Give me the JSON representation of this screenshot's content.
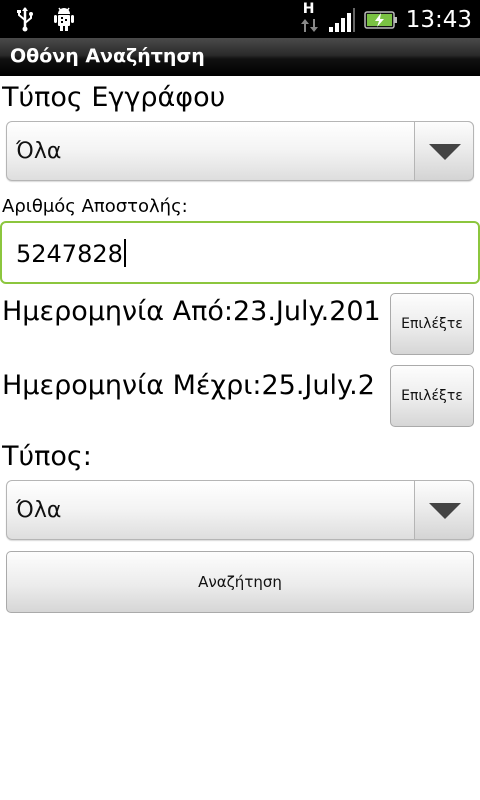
{
  "status_bar": {
    "icons_left": [
      "usb-icon",
      "android-debug-icon"
    ],
    "icons_right": [
      "hspa-data-icon",
      "signal-strength-icon",
      "battery-charging-icon"
    ],
    "network_type": "H",
    "clock": "13:43"
  },
  "title_bar": {
    "title": "Οθόνη Αναζήτηση"
  },
  "form": {
    "document_type_label": "Τύπος Εγγράφου",
    "document_type_value": "Όλα",
    "shipment_number_label": "Αριθμός Αποστολής:",
    "shipment_number_value": "5247828",
    "date_from_label": "Ημερομηνία Από:23.July.201",
    "date_from_button": "Επιλέξτε",
    "date_to_label": "Ημερομηνία Μέχρι:25.July.2",
    "date_to_button": "Επιλέξτε",
    "type_label": "Τύπος:",
    "type_value": "Όλα",
    "search_button": "Αναζήτηση"
  },
  "colors": {
    "focus_border": "#8cc63e",
    "battery_fill": "#7ac143",
    "status_bar_bg": "#000000"
  }
}
